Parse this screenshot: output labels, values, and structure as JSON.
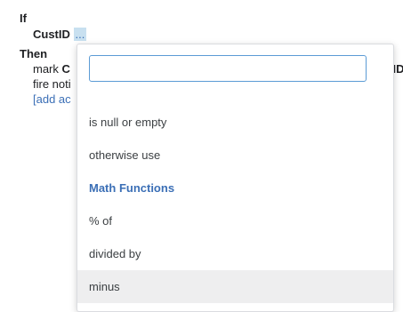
{
  "rule": {
    "if_label": "If",
    "condition_field": "CustID",
    "condition_token": "...",
    "then_label": "Then",
    "action1_prefix": "mark",
    "action1_partial_bold": "C",
    "action1_right_bold": "stID",
    "action1_right_tail": ".",
    "action2_partial": "fire noti",
    "add_action_partial": "[add ac"
  },
  "dropdown": {
    "search_value": "",
    "search_placeholder": "",
    "items": [
      {
        "label": "is null or empty",
        "type": "option"
      },
      {
        "label": "otherwise use",
        "type": "option"
      },
      {
        "label": "Math Functions",
        "type": "category"
      },
      {
        "label": "% of",
        "type": "option"
      },
      {
        "label": "divided by",
        "type": "option"
      },
      {
        "label": "minus",
        "type": "option",
        "hovered": true
      }
    ]
  },
  "colors": {
    "link": "#3b6fb6",
    "token_bg": "#c8e0f0",
    "search_border": "#5b9bd5",
    "hover_bg": "#eeeeef"
  }
}
